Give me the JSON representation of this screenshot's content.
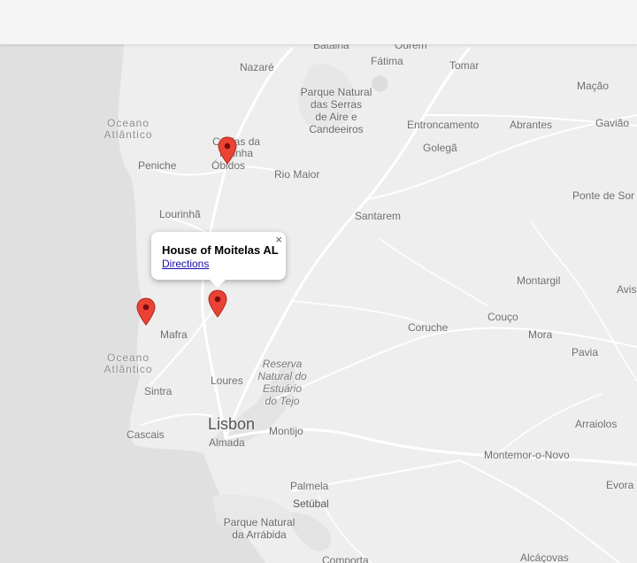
{
  "map": {
    "labels": {
      "batalha": "Batalha",
      "ourem": "Ourém",
      "nazare": "Nazaré",
      "fatima": "Fátima",
      "tomar": "Tomar",
      "macao": "Mação",
      "oceano_north_1": "Oceano",
      "oceano_north_2": "Atlântico",
      "parque_serras_1": "Parque Natural",
      "parque_serras_2": "das Serras",
      "parque_serras_3": "de Aire e",
      "parque_serras_4": "Candeeiros",
      "entroncamento": "Entroncamento",
      "abrantes": "Abrantes",
      "gaviao": "Gavião",
      "caldas_1": "Caldas da",
      "caldas_2": "Rainha",
      "peniche": "Peniche",
      "obidos": "Óbidos",
      "rio_maior": "Rio Maior",
      "golega": "Golegã",
      "ponte_de_sor": "Ponte de Sor",
      "lourinha": "Lourinhã",
      "santarem": "Santarem",
      "montargil": "Montargil",
      "avis": "Avis",
      "mafra": "Mafra",
      "couco": "Couço",
      "coruche": "Coruche",
      "mora": "Mora",
      "oceano_south_1": "Oceano",
      "oceano_south_2": "Atlântico",
      "estuary_1": "Reserva",
      "estuary_2": "Natural do",
      "estuary_3": "Estuário",
      "estuary_4": "do Tejo",
      "pavia": "Pavia",
      "loures": "Loures",
      "sintra": "Sintra",
      "lisbon": "Lisbon",
      "cascais": "Cascais",
      "montijo": "Montijo",
      "almada": "Almada",
      "arraiolos": "Arraiolos",
      "montemor": "Montemor-o-Novo",
      "palmela": "Palmela",
      "setubal": "Setúbal",
      "evora": "Evora",
      "arrabida_1": "Parque Natural",
      "arrabida_2": "da Arrábida",
      "comporta": "Comporta",
      "alcacovas": "Alcáçovas"
    },
    "markers": [
      "map-marker-icon",
      "map-marker-icon",
      "map-marker-icon"
    ],
    "marker_color": "#ea4335",
    "info_window": {
      "title": "House of Moitelas AL",
      "link": "Directions",
      "close": "×"
    }
  }
}
